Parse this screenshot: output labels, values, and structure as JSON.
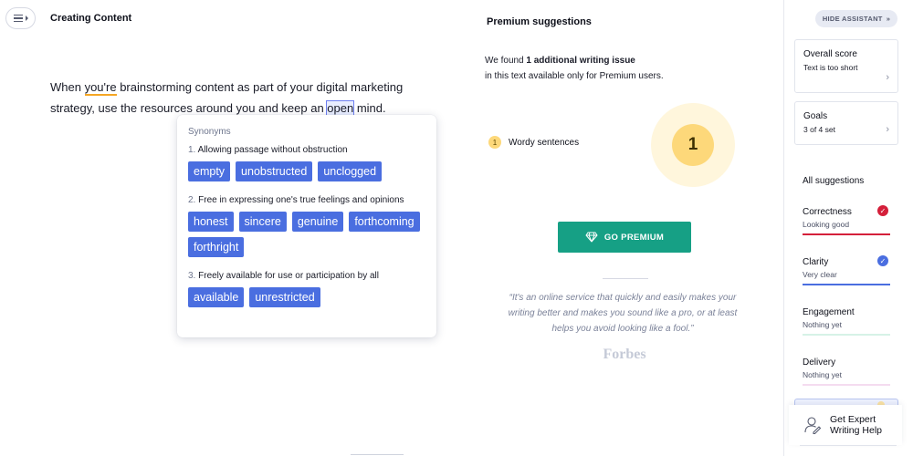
{
  "editor": {
    "doc_title": "Creating Content",
    "text_1": "When ",
    "text_youre": "you're",
    "text_2": " brainstorming content as part of your digital marketing strategy, use the resources around you and keep an ",
    "text_open": "open",
    "text_3": " mind."
  },
  "synonyms": {
    "title": "Synonyms",
    "groups": [
      {
        "num": "1.",
        "definition": "Allowing passage without obstruction",
        "words": [
          "empty",
          "unobstructed",
          "unclogged"
        ]
      },
      {
        "num": "2.",
        "definition": "Free in expressing one's true feelings and opinions",
        "words": [
          "honest",
          "sincere",
          "genuine",
          "forthcoming",
          "forthright"
        ]
      },
      {
        "num": "3.",
        "definition": "Freely available for use or participation by all",
        "words": [
          "available",
          "unrestricted"
        ]
      }
    ]
  },
  "premium": {
    "title": "Premium suggestions",
    "found_prefix": "We found ",
    "found_bold": "1 additional writing issue",
    "found_suffix": "in this text available only for Premium users.",
    "issue_count": "1",
    "issue_label": "Wordy sentences",
    "big_count": "1",
    "button_label": "GO PREMIUM",
    "quote": "“It's an online service that quickly and easily makes your writing better and makes you sound like a pro, or at least helps you avoid looking like a fool.”",
    "quote_source": "Forbes"
  },
  "sidebar": {
    "hide_label": "HIDE ASSISTANT",
    "hide_icon": "double-chevron-right-icon",
    "overall": {
      "title": "Overall score",
      "subtitle": "Text is too short"
    },
    "goals": {
      "title": "Goals",
      "subtitle": "3 of 4 set"
    },
    "all_suggestions": "All suggestions",
    "categories": [
      {
        "name": "Correctness",
        "status": "Looking good",
        "color": "#d41f3a",
        "mark": "checkmark-icon"
      },
      {
        "name": "Clarity",
        "status": "Very clear",
        "color": "#4a6ee0",
        "mark": "checkmark-icon"
      },
      {
        "name": "Engagement",
        "status": "Nothing yet",
        "color": "#d6f2e6",
        "mark": ""
      },
      {
        "name": "Delivery",
        "status": "Nothing yet",
        "color": "#f4dcf0",
        "mark": ""
      }
    ],
    "expert": {
      "label_1": "Get Expert",
      "label_2": "Writing Help"
    }
  },
  "colors": {
    "accent_blue": "#4a6ee0",
    "premium_green": "#16a085",
    "badge_yellow": "#fdd87a",
    "alert_red": "#d41f3a"
  }
}
